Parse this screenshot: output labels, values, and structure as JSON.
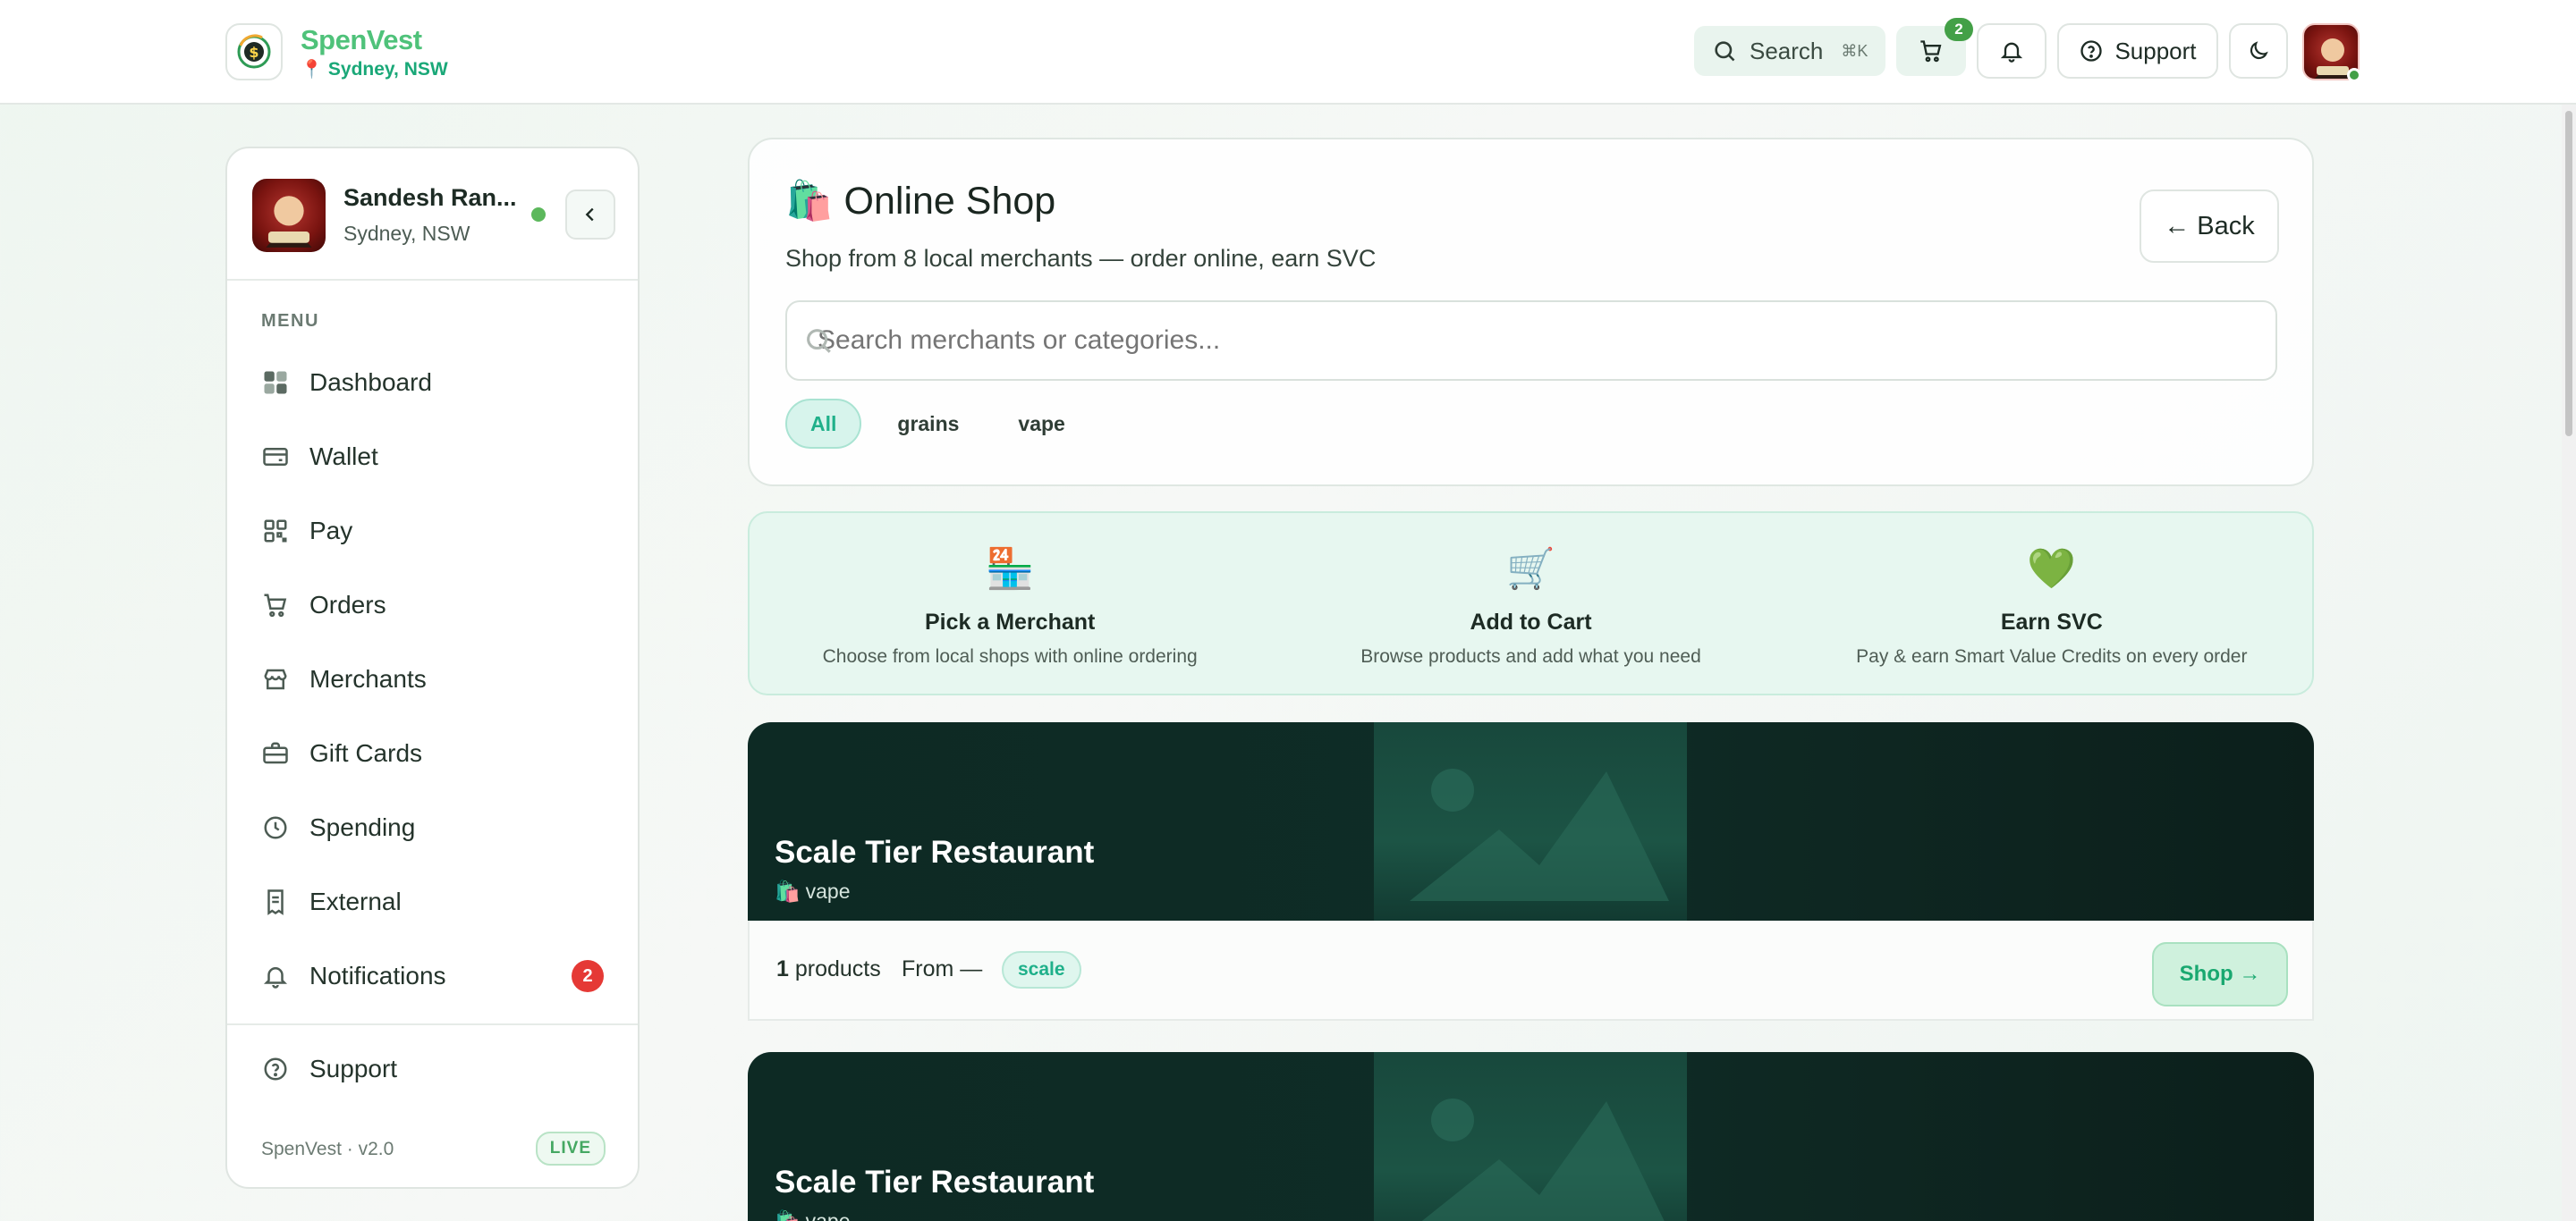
{
  "brand": {
    "name": "SpenVest",
    "location": "Sydney, NSW",
    "logo_icon": "dollar-coin-icon"
  },
  "topbar": {
    "search_label": "Search",
    "search_shortcut": "⌘K",
    "cart_count": "2",
    "support_label": "Support"
  },
  "sidebar": {
    "user_name": "Sandesh Ran...",
    "user_location": "Sydney, NSW",
    "menu_title": "MENU",
    "items": [
      {
        "label": "Dashboard",
        "icon": "grid-icon"
      },
      {
        "label": "Wallet",
        "icon": "wallet-icon"
      },
      {
        "label": "Pay",
        "icon": "qr-icon"
      },
      {
        "label": "Orders",
        "icon": "cart-icon"
      },
      {
        "label": "Merchants",
        "icon": "store-icon"
      },
      {
        "label": "Gift Cards",
        "icon": "gift-card-icon"
      },
      {
        "label": "Spending",
        "icon": "clock-icon"
      },
      {
        "label": "External",
        "icon": "receipt-icon"
      },
      {
        "label": "Notifications",
        "icon": "bell-icon",
        "badge": "2"
      }
    ],
    "support_label": "Support",
    "version": "SpenVest · v2.0",
    "live_label": "LIVE"
  },
  "shop": {
    "title": "Online Shop",
    "title_emoji": "🛍️",
    "subtitle": "Shop from 8 local merchants — order online, earn SVC",
    "back_label": "← Back",
    "search_placeholder": "Search merchants or categories...",
    "chips": [
      {
        "label": "All",
        "active": true
      },
      {
        "label": "grains",
        "active": false
      },
      {
        "label": "vape",
        "active": false
      }
    ]
  },
  "steps": [
    {
      "icon": "🏪",
      "title": "Pick a Merchant",
      "desc": "Choose from local shops with online ordering"
    },
    {
      "icon": "🛒",
      "title": "Add to Cart",
      "desc": "Browse products and add what you need"
    },
    {
      "icon": "💚",
      "title": "Earn SVC",
      "desc": "Pay & earn Smart Value Credits on every order"
    }
  ],
  "merchants": [
    {
      "name": "Scale Tier Restaurant",
      "category": "vape",
      "category_emoji": "🛍️",
      "product_count": "1",
      "products_suffix": "products",
      "from_label": "From —",
      "tag": "scale",
      "shop_label": "Shop →"
    },
    {
      "name": "Scale Tier Restaurant",
      "category": "vape",
      "category_emoji": "🛍️"
    }
  ],
  "colors": {
    "brand_green": "#4fc27a",
    "accent_teal": "#20b08a",
    "badge_red": "#e53935",
    "banner_dark": "#0d2a24"
  }
}
